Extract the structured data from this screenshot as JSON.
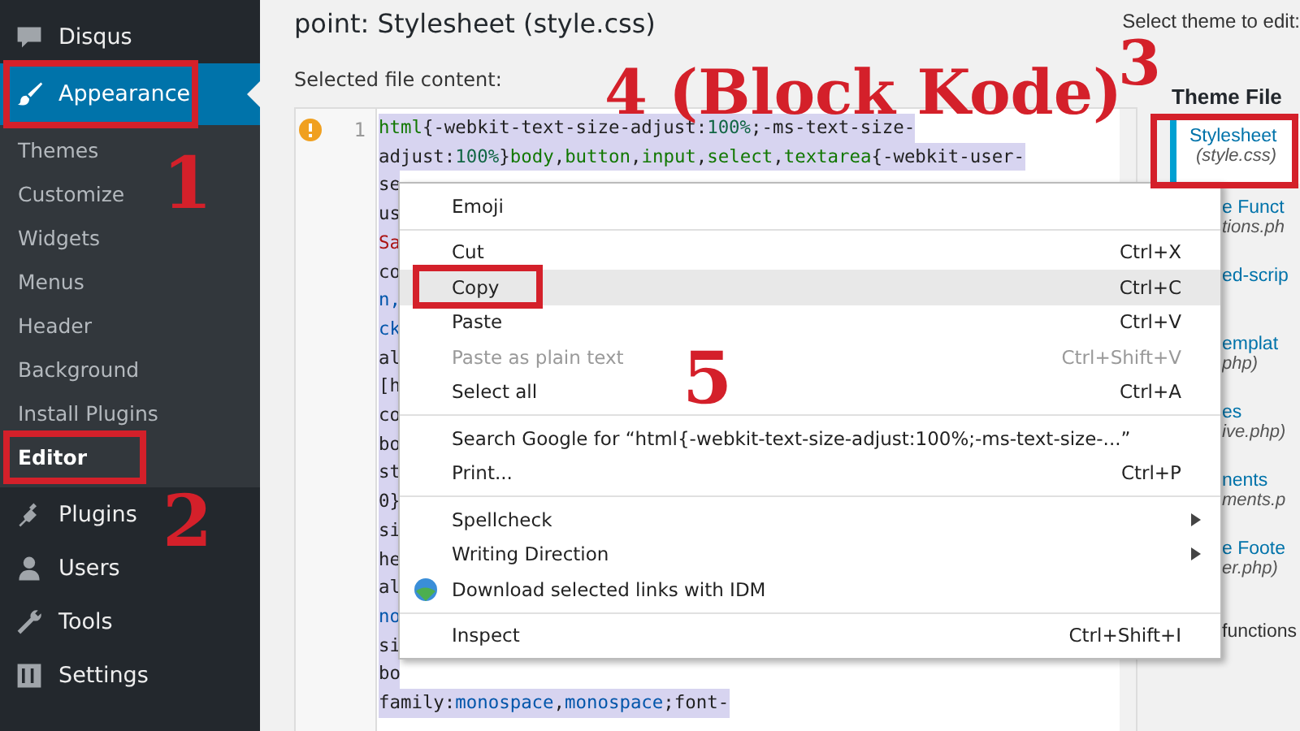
{
  "sidebar": {
    "items": [
      {
        "label": "Disqus",
        "current": false
      },
      {
        "label": "Appearance",
        "current": true,
        "children": [
          {
            "label": "Themes",
            "selected": false
          },
          {
            "label": "Customize",
            "selected": false
          },
          {
            "label": "Widgets",
            "selected": false
          },
          {
            "label": "Menus",
            "selected": false
          },
          {
            "label": "Header",
            "selected": false
          },
          {
            "label": "Background",
            "selected": false
          },
          {
            "label": "Install Plugins",
            "selected": false
          },
          {
            "label": "Editor",
            "selected": true
          }
        ]
      },
      {
        "label": "Plugins",
        "current": false
      },
      {
        "label": "Users",
        "current": false
      },
      {
        "label": "Tools",
        "current": false
      },
      {
        "label": "Settings",
        "current": false
      }
    ]
  },
  "page": {
    "title": "point: Stylesheet (style.css)",
    "select_theme_label": "Select theme to edit:",
    "content_label": "Selected file content:"
  },
  "editor": {
    "selected": true,
    "line_number": "1",
    "lines": [
      [
        {
          "text": "html",
          "kind": "tag"
        },
        {
          "text": "{-webkit-text-size-adjust:",
          "kind": "plain"
        },
        {
          "text": "100%",
          "kind": "num"
        },
        {
          "text": ";-ms-text-size-",
          "kind": "plain"
        }
      ],
      [
        {
          "text": "adjust:",
          "kind": "plain"
        },
        {
          "text": "100%",
          "kind": "num"
        },
        {
          "text": "}",
          "kind": "plain"
        },
        {
          "text": "body",
          "kind": "tag"
        },
        {
          "text": ",",
          "kind": "plain"
        },
        {
          "text": "button",
          "kind": "tag"
        },
        {
          "text": ",",
          "kind": "plain"
        },
        {
          "text": "input",
          "kind": "tag"
        },
        {
          "text": ",",
          "kind": "plain"
        },
        {
          "text": "select",
          "kind": "tag"
        },
        {
          "text": ",",
          "kind": "plain"
        },
        {
          "text": "textarea",
          "kind": "tag"
        },
        {
          "text": "{-webkit-user-",
          "kind": "plain"
        }
      ],
      [
        {
          "text": "se",
          "kind": "plain"
        }
      ],
      [
        {
          "text": "us",
          "kind": "plain"
        }
      ],
      [
        {
          "text": "Sa",
          "kind": "string"
        }
      ],
      [
        {
          "text": "co",
          "kind": "plain"
        }
      ],
      [
        {
          "text": "n,",
          "kind": "attr"
        }
      ],
      [
        {
          "text": "ck",
          "kind": "attr"
        }
      ],
      [
        {
          "text": "al",
          "kind": "plain"
        }
      ],
      [
        {
          "text": "[h",
          "kind": "plain"
        }
      ],
      [
        {
          "text": "co",
          "kind": "plain"
        }
      ],
      [
        {
          "text": "bo",
          "kind": "plain"
        }
      ],
      [
        {
          "text": "st",
          "kind": "plain"
        }
      ],
      [
        {
          "text": "0}",
          "kind": "plain"
        }
      ],
      [
        {
          "text": "si",
          "kind": "plain"
        }
      ],
      [
        {
          "text": "he",
          "kind": "plain"
        }
      ],
      [
        {
          "text": "al",
          "kind": "plain"
        }
      ],
      [
        {
          "text": "no",
          "kind": "attr"
        }
      ],
      [
        {
          "text": "si",
          "kind": "plain"
        }
      ],
      [
        {
          "text": "bo",
          "kind": "plain"
        }
      ],
      [
        {
          "text": "family:",
          "kind": "plain"
        },
        {
          "text": "monospace",
          "kind": "attr"
        },
        {
          "text": ",",
          "kind": "plain"
        },
        {
          "text": "monospace",
          "kind": "attr"
        },
        {
          "text": ";font-",
          "kind": "plain"
        }
      ]
    ]
  },
  "theme_files": {
    "heading": "Theme File",
    "items": [
      {
        "name": "Stylesheet",
        "file": "(style.css)",
        "selected": true,
        "kind": "file"
      },
      {
        "name": "e Funct",
        "file": "tions.ph",
        "selected": false,
        "kind": "file"
      },
      {
        "name": "ed-scrip",
        "selected": false,
        "kind": "file"
      },
      {
        "name": "emplat",
        "file": "php)",
        "selected": false,
        "kind": "file"
      },
      {
        "name": "es",
        "file": "ive.php)",
        "selected": false,
        "kind": "file"
      },
      {
        "name": "nents",
        "file": "ments.p",
        "selected": false,
        "kind": "file"
      },
      {
        "name": "e Foote",
        "file": "er.php)",
        "selected": false,
        "kind": "file"
      },
      {
        "name": "functions",
        "selected": false,
        "kind": "folder"
      }
    ]
  },
  "context_menu": {
    "groups": [
      [
        {
          "label": "Emoji",
          "kind": "plain",
          "disabled": false,
          "selected": false
        }
      ],
      [
        {
          "label": "Cut",
          "shortcut": "Ctrl+X",
          "kind": "plain",
          "disabled": false,
          "selected": false
        },
        {
          "label": "Copy",
          "shortcut": "Ctrl+C",
          "kind": "plain",
          "disabled": false,
          "selected": true
        },
        {
          "label": "Paste",
          "shortcut": "Ctrl+V",
          "kind": "plain",
          "disabled": false,
          "selected": false
        },
        {
          "label": "Paste as plain text",
          "shortcut": "Ctrl+Shift+V",
          "kind": "plain",
          "disabled": true,
          "selected": false
        },
        {
          "label": "Select all",
          "shortcut": "Ctrl+A",
          "kind": "plain",
          "disabled": false,
          "selected": false
        }
      ],
      [
        {
          "label": "Search Google for “html{-webkit-text-size-adjust:100%;-ms-text-size-...”",
          "kind": "plain",
          "disabled": false,
          "selected": false
        },
        {
          "label": "Print...",
          "shortcut": "Ctrl+P",
          "kind": "plain",
          "disabled": false,
          "selected": false
        }
      ],
      [
        {
          "label": "Spellcheck",
          "kind": "submenu",
          "disabled": false,
          "selected": false
        },
        {
          "label": "Writing Direction",
          "kind": "submenu",
          "disabled": false,
          "selected": false
        },
        {
          "label": "Download selected links with IDM",
          "kind": "icon",
          "disabled": false,
          "selected": false
        }
      ],
      [
        {
          "label": "Inspect",
          "shortcut": "Ctrl+Shift+I",
          "kind": "plain",
          "disabled": false,
          "selected": false
        }
      ]
    ]
  },
  "annotations": [
    {
      "label": "1"
    },
    {
      "label": "2"
    },
    {
      "label": "3"
    },
    {
      "label": "4 (Block Kode)"
    },
    {
      "label": "5"
    }
  ]
}
